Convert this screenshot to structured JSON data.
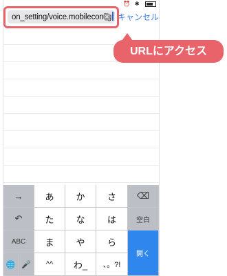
{
  "browser": {
    "url_text": "on_setting/voice.mobileconfig",
    "cancel_label": "キャンセル"
  },
  "annotation": {
    "callout_text": "URLにアクセス",
    "color": "#e8636a"
  },
  "keyboard": {
    "rows": [
      [
        "→",
        "あ",
        "か",
        "さ",
        "⌫"
      ],
      [
        "↶",
        "た",
        "な",
        "は",
        "空白"
      ],
      [
        "ABC",
        "ま",
        "や",
        "ら",
        "開く"
      ],
      [
        "🌐",
        "🎤",
        "^^",
        "わ_",
        "、。?!"
      ]
    ],
    "open_color": "#2f86ec"
  },
  "status_bar": {
    "icons": [
      "alarm-icon",
      "bluetooth-icon",
      "battery-icon"
    ]
  }
}
